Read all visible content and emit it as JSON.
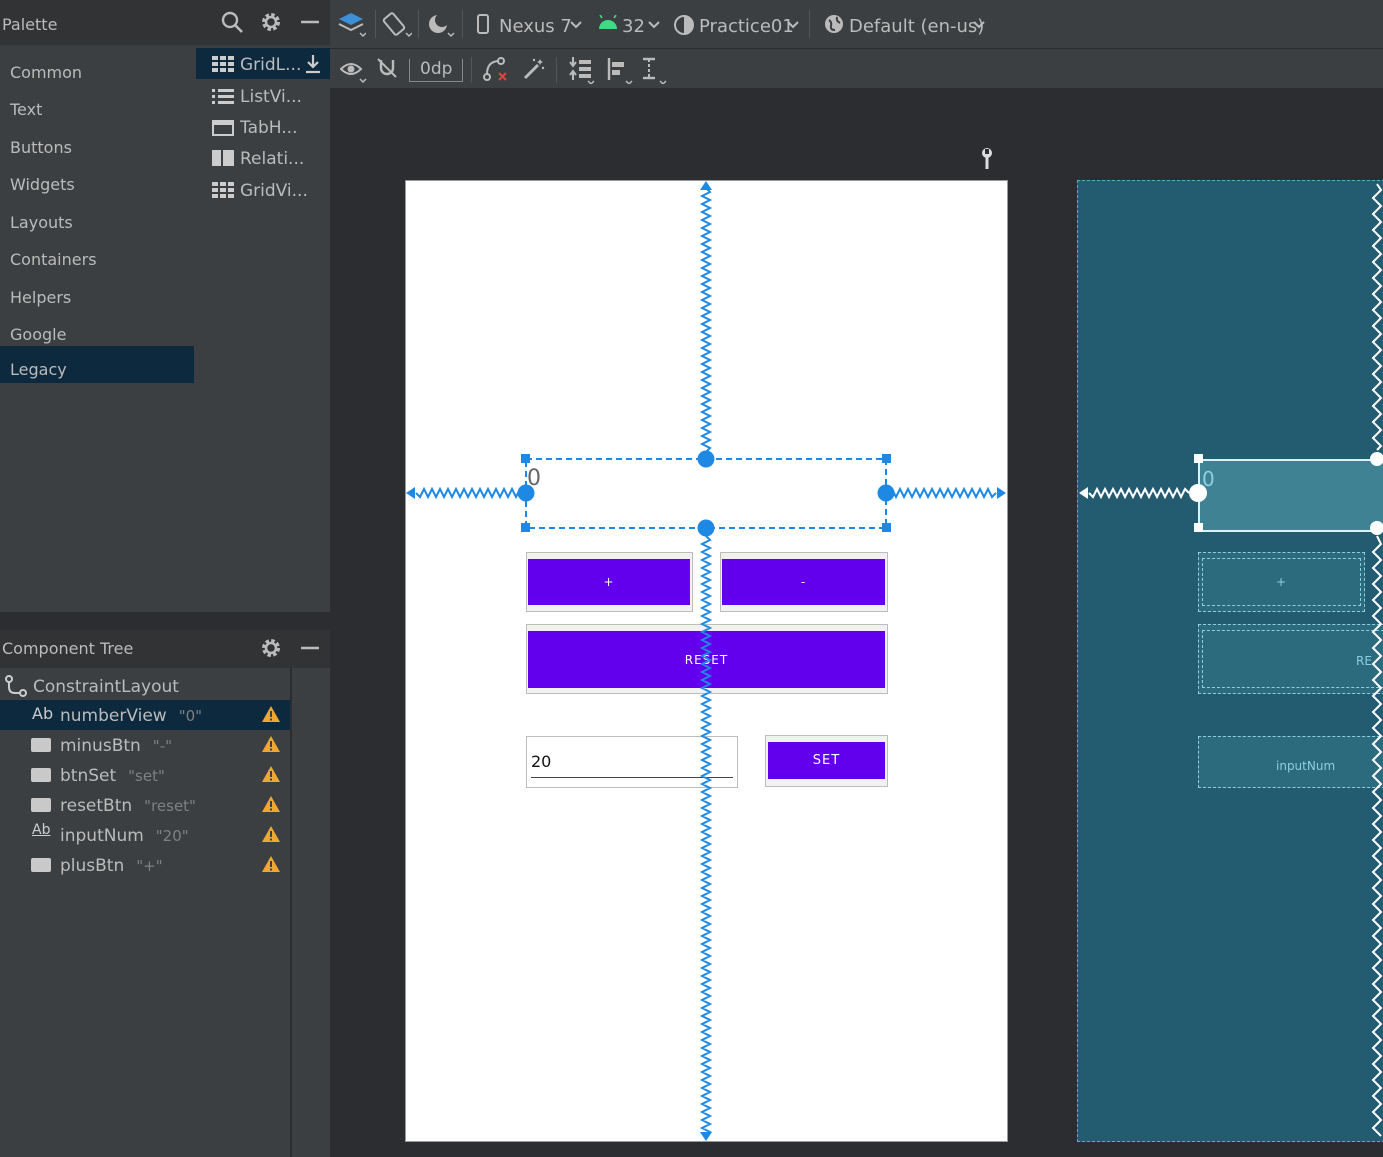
{
  "palette": {
    "title": "Palette",
    "categories": [
      "Common",
      "Text",
      "Buttons",
      "Widgets",
      "Layouts",
      "Containers",
      "Helpers",
      "Google",
      "Legacy"
    ],
    "selected_category": "Legacy",
    "items": [
      "GridL...",
      "ListVi...",
      "TabH...",
      "Relati...",
      "GridVi..."
    ]
  },
  "component_tree": {
    "title": "Component Tree",
    "root": "ConstraintLayout",
    "nodes": [
      {
        "name": "numberView",
        "value": "\"0\"",
        "icon": "textview-icon"
      },
      {
        "name": "minusBtn",
        "value": "\"-\"",
        "icon": "button-icon"
      },
      {
        "name": "btnSet",
        "value": "\"set\"",
        "icon": "button-icon"
      },
      {
        "name": "resetBtn",
        "value": "\"reset\"",
        "icon": "button-icon"
      },
      {
        "name": "inputNum",
        "value": "\"20\"",
        "icon": "edittext-icon"
      },
      {
        "name": "plusBtn",
        "value": "\"+\"",
        "icon": "button-icon"
      }
    ]
  },
  "toolbar": {
    "device": "Nexus 7",
    "api": "32",
    "theme": "Practice01",
    "locale": "Default (en-us)",
    "margin": "0dp"
  },
  "design": {
    "number_text": "0",
    "plus_label": "+",
    "minus_label": "-",
    "reset_label": "RESET",
    "input_value": "20",
    "set_label": "SET"
  },
  "blueprint": {
    "plus_label": "+",
    "reset_label": "RE",
    "input_label": "inputNum",
    "number_text": "0"
  },
  "colors": {
    "accent": "#6200ee",
    "constraint": "#1e88e5",
    "warning": "#f0a732",
    "blueprint_bg": "#235b70",
    "selection": "#0d293e"
  }
}
